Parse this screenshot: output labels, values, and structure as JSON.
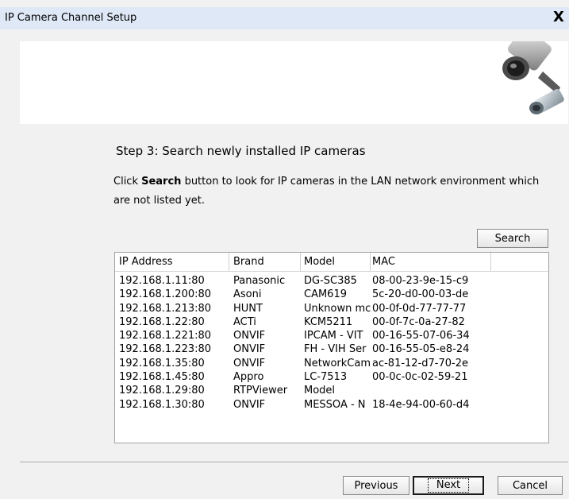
{
  "window": {
    "title": "IP Camera Channel Setup",
    "close_label": "X"
  },
  "step": {
    "title": "Step 3: Search newly installed IP cameras",
    "desc_pre": "Click ",
    "desc_bold": "Search",
    "desc_post": " button to look for IP cameras in the LAN network environment which are not listed yet."
  },
  "search_button": "Search",
  "table": {
    "columns": [
      "IP Address",
      "Brand",
      "Model",
      "MAC",
      ""
    ],
    "rows": [
      {
        "ip": "192.168.1.11:80",
        "brand": "Panasonic",
        "model": "DG-SC385",
        "mac": "08-00-23-9e-15-c9"
      },
      {
        "ip": "192.168.1.200:80",
        "brand": "Asoni",
        "model": "CAM619",
        "mac": "5c-20-d0-00-03-de"
      },
      {
        "ip": "192.168.1.213:80",
        "brand": "HUNT",
        "model": "Unknown mc",
        "mac": "00-0f-0d-77-77-77"
      },
      {
        "ip": "192.168.1.22:80",
        "brand": "ACTi",
        "model": "KCM5211",
        "mac": "00-0f-7c-0a-27-82"
      },
      {
        "ip": "192.168.1.221:80",
        "brand": "ONVIF",
        "model": "IPCAM - VIT",
        "mac": "00-16-55-07-06-34"
      },
      {
        "ip": "192.168.1.223:80",
        "brand": "ONVIF",
        "model": "FH - VIH Ser",
        "mac": "00-16-55-05-e8-24"
      },
      {
        "ip": "192.168.1.35:80",
        "brand": "ONVIF",
        "model": "NetworkCam",
        "mac": "ac-81-12-d7-70-2e"
      },
      {
        "ip": "192.168.1.45:80",
        "brand": "Appro",
        "model": "LC-7513",
        "mac": "00-0c-0c-02-59-21"
      },
      {
        "ip": "192.168.1.29:80",
        "brand": "RTPViewer",
        "model": "Model",
        "mac": ""
      },
      {
        "ip": "192.168.1.30:80",
        "brand": "ONVIF",
        "model": "MESSOA - N",
        "mac": "18-4e-94-00-60-d4"
      }
    ]
  },
  "footer": {
    "previous_label": "Previous",
    "next_label": "Next",
    "cancel_label": "Cancel"
  }
}
